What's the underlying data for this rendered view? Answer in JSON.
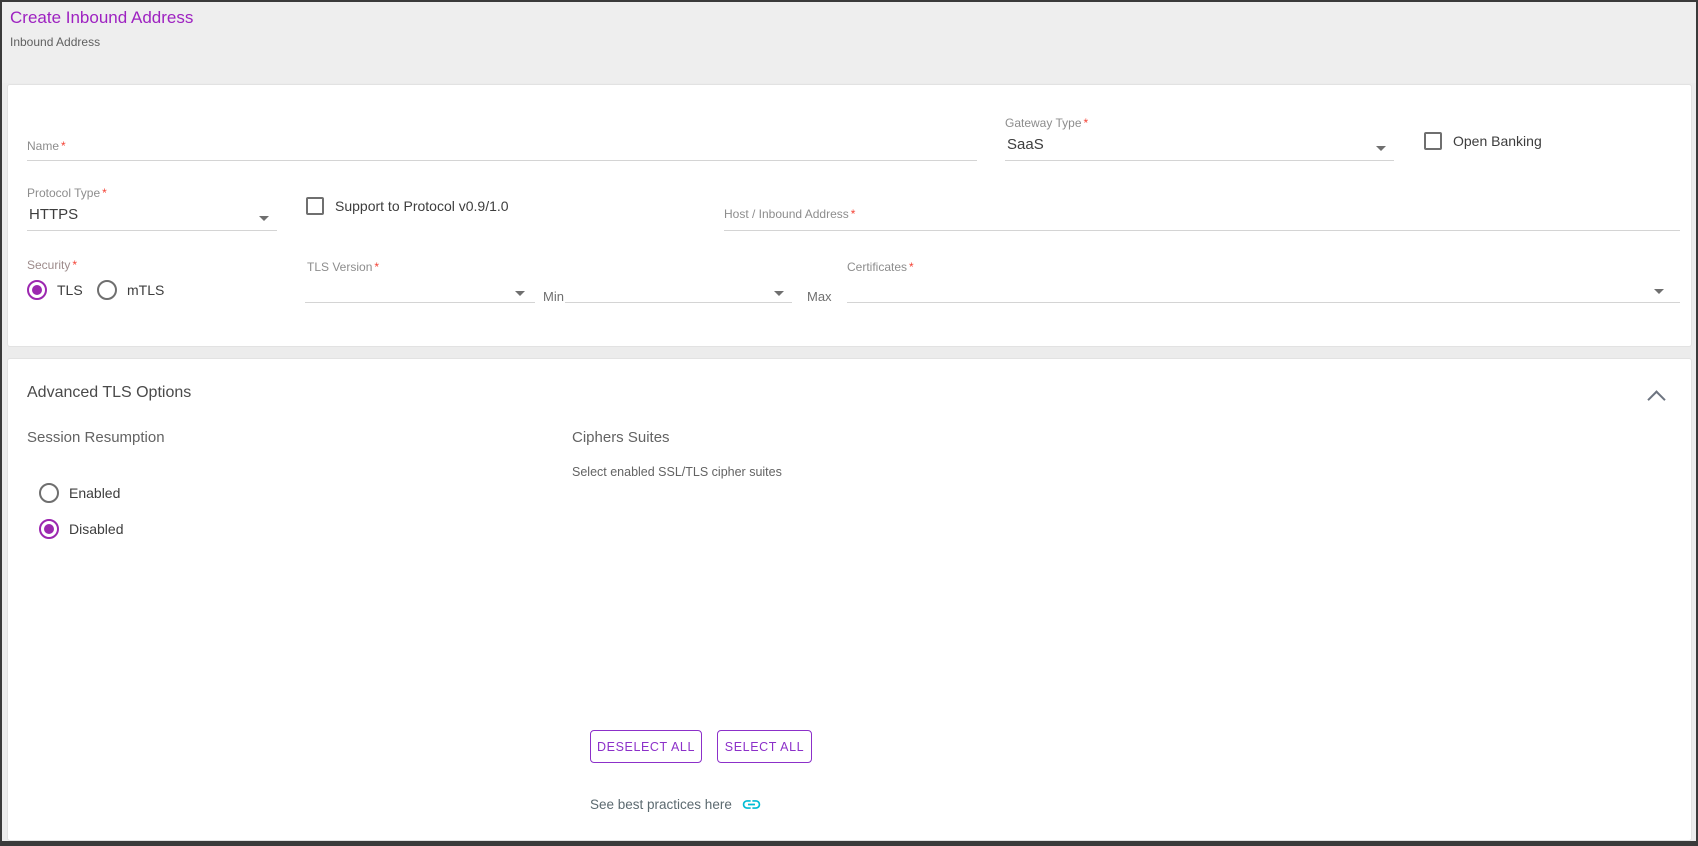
{
  "page": {
    "title": "Create Inbound Address",
    "subtitle": "Inbound Address"
  },
  "form": {
    "name": {
      "label": "Name",
      "required": "*",
      "value": ""
    },
    "gateway_type": {
      "label": "Gateway Type",
      "required": "*",
      "value": "SaaS"
    },
    "open_banking": {
      "label": "Open Banking",
      "checked": false
    },
    "protocol_type": {
      "label": "Protocol Type",
      "required": "*",
      "value": "HTTPS"
    },
    "support_protocol": {
      "label": "Support to Protocol v0.9/1.0",
      "checked": false
    },
    "host": {
      "label": "Host / Inbound Address",
      "required": "*",
      "value": ""
    },
    "security": {
      "label": "Security",
      "required": "*",
      "options": [
        "TLS",
        "mTLS"
      ],
      "selected": "TLS"
    },
    "tls_version": {
      "label": "TLS Version",
      "required": "*",
      "min_label": "Min",
      "max_label": "Max",
      "min_value": "",
      "max_value": ""
    },
    "certificates": {
      "label": "Certificates",
      "required": "*",
      "value": ""
    }
  },
  "advanced": {
    "title": "Advanced TLS Options",
    "expanded": true,
    "session_resumption": {
      "title": "Session Resumption",
      "options": [
        "Enabled",
        "Disabled"
      ],
      "selected": "Disabled"
    },
    "ciphers": {
      "title": "Ciphers Suites",
      "subtitle": "Select enabled SSL/TLS cipher suites",
      "deselect_all_label": "DESELECT ALL",
      "select_all_label": "SELECT ALL",
      "best_practices_label": "See best practices here"
    }
  },
  "colors": {
    "title_purple": "#9e22c1",
    "accent_purple": "#9c27b0",
    "button_purple": "#8c30c9",
    "link_cyan": "#00bcd4",
    "asterisk_red": "#f44336",
    "header_bg": "#eeeeee",
    "page_bg": "#ececec"
  }
}
